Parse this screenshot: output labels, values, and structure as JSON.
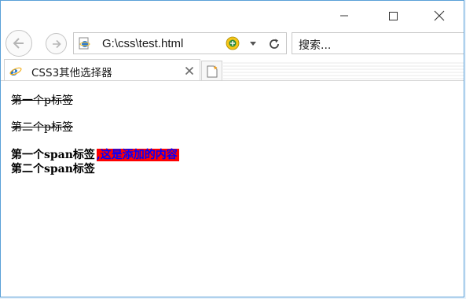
{
  "window": {
    "minimize_icon": "minimize-icon",
    "maximize_icon": "maximize-icon",
    "close_icon": "close-icon"
  },
  "navigation": {
    "back_icon": "back-arrow-icon",
    "forward_icon": "forward-arrow-icon",
    "address": "G:\\css\\test.html",
    "refresh_icon": "refresh-icon",
    "compat_icon": "compatibility-view-icon",
    "search_placeholder": "搜索..."
  },
  "tabs": [
    {
      "title": "CSS3其他选择器",
      "icon": "ie-logo-icon",
      "active": true
    }
  ],
  "page": {
    "paragraphs": [
      "第一个p标签",
      "第二个p标签"
    ],
    "spans": [
      "第一个span标签",
      "第二个span标签"
    ],
    "added_content": ",这是添加的内容"
  },
  "colors": {
    "added_background": "#ff0000",
    "added_text": "#0000ff",
    "window_border": "#5aa0d8"
  }
}
